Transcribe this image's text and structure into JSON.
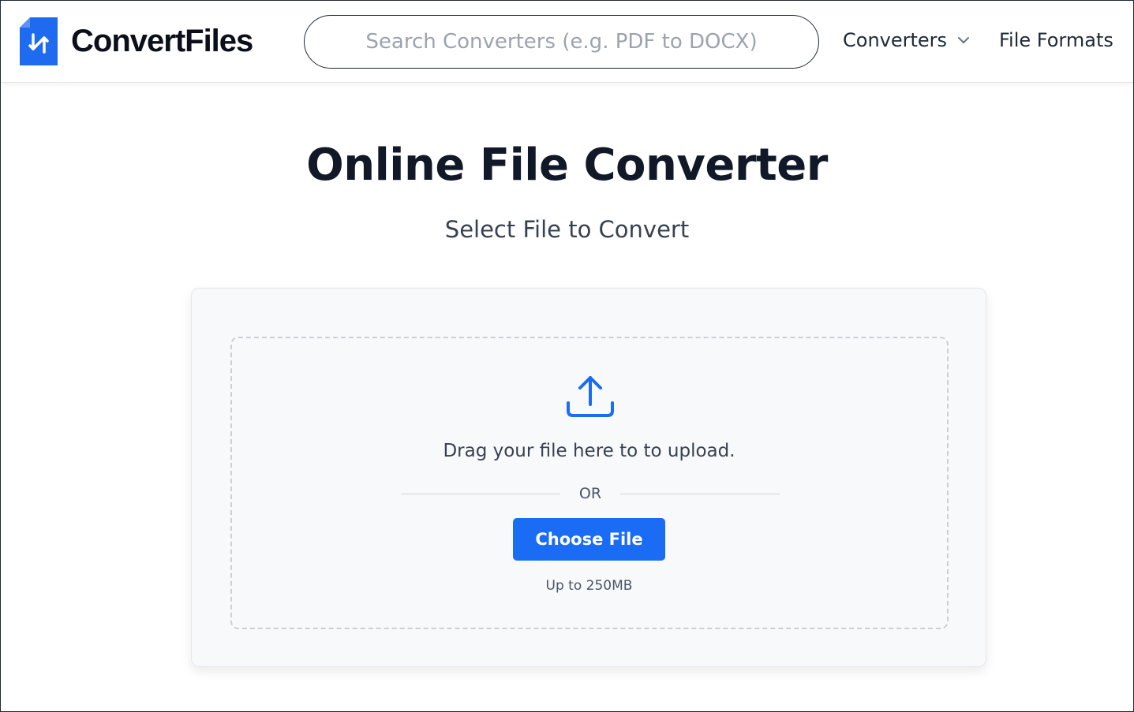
{
  "header": {
    "logo_text": "ConvertFiles",
    "search_placeholder": "Search Converters (e.g. PDF to DOCX)",
    "nav": {
      "converters_label": "Converters",
      "file_formats_label": "File Formats"
    }
  },
  "hero": {
    "title": "Online File Converter",
    "subtitle": "Select File to Convert"
  },
  "upload": {
    "drag_text": "Drag your file here to to upload.",
    "or_text": "OR",
    "choose_button_label": "Choose File",
    "size_limit": "Up to 250MB"
  },
  "icons": {
    "logo": "logo-file-convert-icon",
    "nav_chevron": "chevron-down-icon",
    "upload": "upload-icon"
  },
  "colors": {
    "brand_blue": "#1a6cf5",
    "logo_blue": "#1f6bef",
    "text_dark": "#111827",
    "card_bg": "#f8f9fb"
  }
}
